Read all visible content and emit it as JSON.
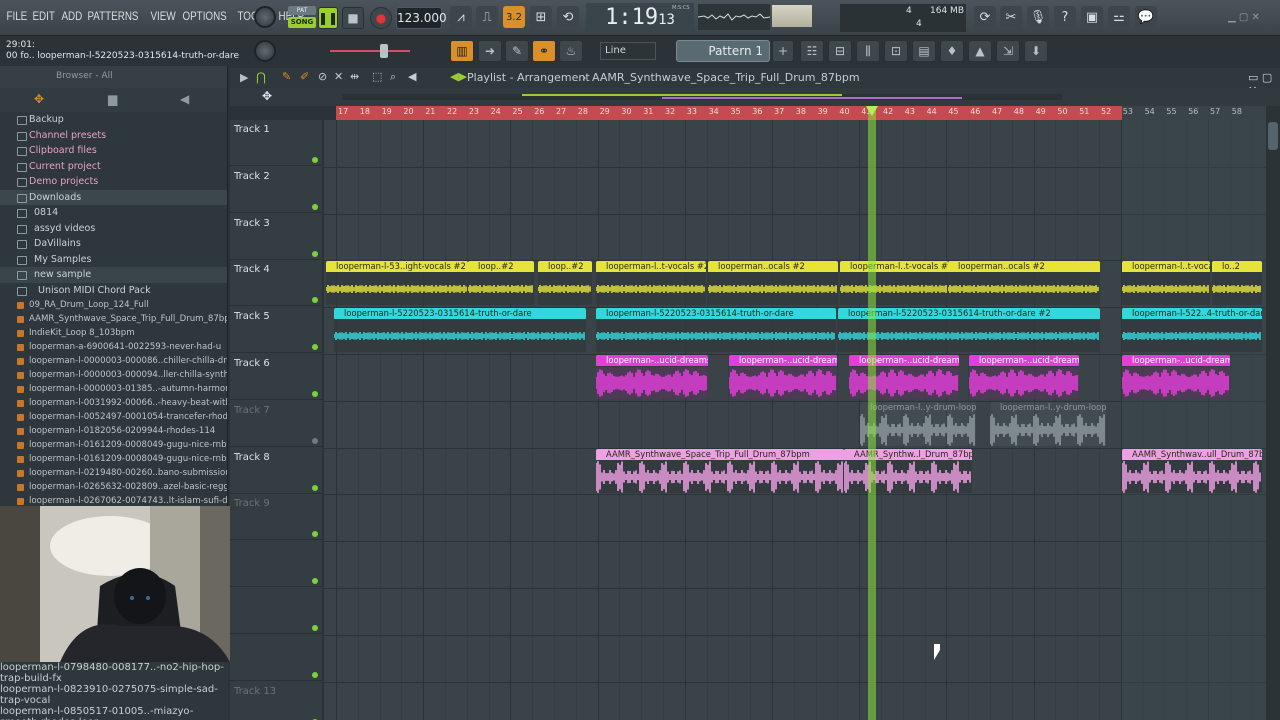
{
  "menu": [
    "FILE",
    "EDIT",
    "ADD",
    "PATTERNS",
    "VIEW",
    "OPTIONS",
    "TOOLS",
    "HELP"
  ],
  "transport": {
    "pat_label": "PAT",
    "song_label": "SONG",
    "tempo": "123.000",
    "time_main": "1:19",
    "time_sub": "13",
    "time_unit": "M:S:CS",
    "mem_a": "4",
    "mem_b": "164 MB",
    "mem_c": "4",
    "snap_value": "3.2"
  },
  "hint": {
    "line1": "29:01:",
    "line2": "00 fo.. looperman-l-5220523-0315614-truth-or-dare"
  },
  "line_mode": "Line",
  "pattern": "Pattern 1",
  "browser": {
    "title": "Browser - All",
    "items": [
      {
        "label": "Backup",
        "pink": false
      },
      {
        "label": "Channel presets",
        "pink": true
      },
      {
        "label": "Clipboard files",
        "pink": true
      },
      {
        "label": "Current project",
        "pink": true
      },
      {
        "label": "Demo projects",
        "pink": true
      },
      {
        "label": "Downloads",
        "pink": false
      },
      {
        "label": "0814",
        "pink": false
      },
      {
        "label": "assyd videos",
        "pink": false
      },
      {
        "label": "DaVillains",
        "pink": false
      },
      {
        "label": "My Samples",
        "pink": false
      },
      {
        "label": "new sample",
        "pink": false
      },
      {
        "label": "Unison MIDI Chord Pack",
        "pink": false
      }
    ],
    "files": [
      "09_RA_Drum_Loop_124_Full",
      "AAMR_Synthwave_Space_Trip_Full_Drum_87bpm",
      "IndieKit_Loop 8_103bpm",
      "looperman-a-6900641-0022593-never-had-u",
      "looperman-l-0000003-000086..chiller-chilla-dream-pad-2",
      "looperman-l-0000003-000094..ller-chilla-synth-skank-riff",
      "looperman-l-0000003-01385..-autumn-harmony-flute-high",
      "looperman-l-0031992-00066..-heavy-beat-with-hat-gallop",
      "looperman-l-0052497-0001054-trancefer-rhodes-on-stage",
      "looperman-l-0182056-0209944-rhodes-114",
      "looperman-l-0161209-0008049-gugu-nice-rnb (1)",
      "looperman-l-0161209-0008049-gugu-nice-rnb",
      "looperman-l-0219480-00260..bano-submission-drum-loop",
      "looperman-l-0265632-002809..azel-basic-reggaeton-drums",
      "looperman-l-0267062-0074743..lt-islam-sufi-dervish-vocal"
    ],
    "files_bottom": [
      "looperman-l-0798480-008177..-no2-hip-hop-trap-build-fx",
      "looperman-l-0823910-0275075-simple-sad-trap-vocal",
      "looperman-l-0850517-01005..-miazyo-smooth-rhodes-loop",
      "looperman-l-0850517-01006..-miazyo-hip-hop-drum-loop"
    ]
  },
  "playlist": {
    "title": "Playlist - Arrangement",
    "project": "AAMR_Synthwave_Space_Trip_Full_Drum_87bpm",
    "ruler": [
      "17",
      "18",
      "19",
      "20",
      "21",
      "22",
      "23",
      "24",
      "25",
      "26",
      "27",
      "28",
      "29",
      "30",
      "31",
      "32",
      "33",
      "34",
      "35",
      "36",
      "37",
      "38",
      "39",
      "40",
      "41",
      "42",
      "43",
      "44",
      "45",
      "46",
      "47",
      "48",
      "49",
      "50",
      "51",
      "52",
      "53",
      "54",
      "55",
      "56",
      "57",
      "58"
    ],
    "tracks": [
      "Track 1",
      "Track 2",
      "Track 3",
      "Track 4",
      "Track 5",
      "Track 6",
      "Track 7",
      "Track 8",
      "Track 9",
      "",
      "",
      "",
      "Track 13"
    ],
    "clips": [
      {
        "label": "looperman-l-53..ight-vocals #2",
        "color": "#e6e43a"
      },
      {
        "label": "loop..#2",
        "color": "#e6e43a"
      },
      {
        "label": "loop..#2",
        "color": "#e6e43a"
      },
      {
        "label": "looperman-l..t-vocals #2",
        "color": "#e6e43a"
      },
      {
        "label": "looperman..ocals #2",
        "color": "#e6e43a"
      },
      {
        "label": "looperman-l..t-vocals #3",
        "color": "#e6e43a"
      },
      {
        "label": "looperman..ocals #2",
        "color": "#e6e43a"
      },
      {
        "label": "looperman-l..t-vocals #2",
        "color": "#e6e43a"
      },
      {
        "label": "lo..2",
        "color": "#e6e43a"
      },
      {
        "label": "looperman-l-5220523-0315614-truth-or-dare",
        "color": "#34d7dc"
      },
      {
        "label": "looperman-l-5220523-0315614-truth-or-dare",
        "color": "#34d7dc"
      },
      {
        "label": "looperman-l-5220523-0315614-truth-or-dare #2",
        "color": "#34d7dc"
      },
      {
        "label": "looperman-l-522..4-truth-or-dare",
        "color": "#34d7dc"
      },
      {
        "label": "looperman-..ucid-dreams",
        "color": "#e33ed9"
      },
      {
        "label": "looperman-..ucid-dreams",
        "color": "#e33ed9"
      },
      {
        "label": "looperman-..ucid-dreams",
        "color": "#e33ed9"
      },
      {
        "label": "looperman-..ucid-dreams",
        "color": "#e33ed9"
      },
      {
        "label": "looperman-..ucid-dreams",
        "color": "#e33ed9"
      },
      {
        "label": "looperman-l..y-drum-loop",
        "color": "#6f7b80"
      },
      {
        "label": "looperman-l..y-drum-loop",
        "color": "#6f7b80"
      },
      {
        "label": "AAMR_Synthwave_Space_Trip_Full_Drum_87bpm",
        "color": "#ef9fe3"
      },
      {
        "label": "AAMR_Synthw..l_Drum_87bpm",
        "color": "#ef9fe3"
      },
      {
        "label": "AAMR_Synthwav..ull_Drum_87bpm",
        "color": "#ef9fe3"
      }
    ]
  }
}
